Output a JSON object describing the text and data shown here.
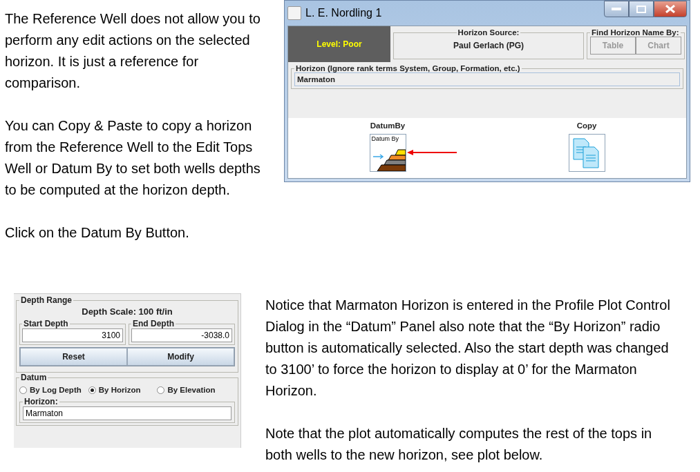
{
  "intro": {
    "paragraphs": [
      "The Reference Well does not allow you to perform any edit actions on the selected horizon.  It is just a reference for comparison.",
      "You can Copy & Paste to copy a horizon from the Reference Well to the Edit Tops Well or Datum By to set both wells depths to be computed at the horizon depth.",
      "Click on the Datum By Button."
    ]
  },
  "dialog_window": {
    "title": "L. E. Nordling 1",
    "level_label": "Level: Poor",
    "horizon_source": {
      "legend": "Horizon Source:",
      "value": "Paul Gerlach (PG)"
    },
    "find_by": {
      "legend": "Find Horizon Name By:",
      "buttons": [
        {
          "label": "Table",
          "disabled": true
        },
        {
          "label": "Chart",
          "disabled": true
        }
      ]
    },
    "horizon": {
      "legend": "Horizon (Ignore rank terms System, Group, Formation, etc.)",
      "value": "Marmaton"
    },
    "actions": [
      {
        "kind": "datum",
        "label": "DatumBy",
        "icon_text": "Datum By"
      },
      {
        "kind": "copy",
        "label": "Copy"
      }
    ]
  },
  "control_panel": {
    "depth_range": {
      "legend": "Depth Range",
      "scale": "Depth Scale: 100 ft/in",
      "start": {
        "legend": "Start Depth",
        "value": "3100"
      },
      "end": {
        "legend": "End Depth",
        "value": "-3038.0"
      },
      "buttons": [
        "Reset",
        "Modify"
      ]
    },
    "datum": {
      "legend": "Datum",
      "options": [
        {
          "label": "By Log Depth",
          "selected": false
        },
        {
          "label": "By Horizon",
          "selected": true
        },
        {
          "label": "By Elevation",
          "selected": false
        }
      ],
      "horizon": {
        "legend": "Horizon:",
        "value": "Marmaton"
      }
    }
  },
  "notes": {
    "paragraphs": [
      "Notice that Marmaton Horizon is entered in the Profile Plot Control Dialog in the “Datum” Panel also note that the “By Horizon” radio button is automatically selected.  Also the start depth was changed to 3100’ to force the horizon to display at 0’ for the Marmaton Horizon.",
      "Note that the plot automatically computes the rest of the tops in both wells to the new horizon, see plot below."
    ]
  }
}
